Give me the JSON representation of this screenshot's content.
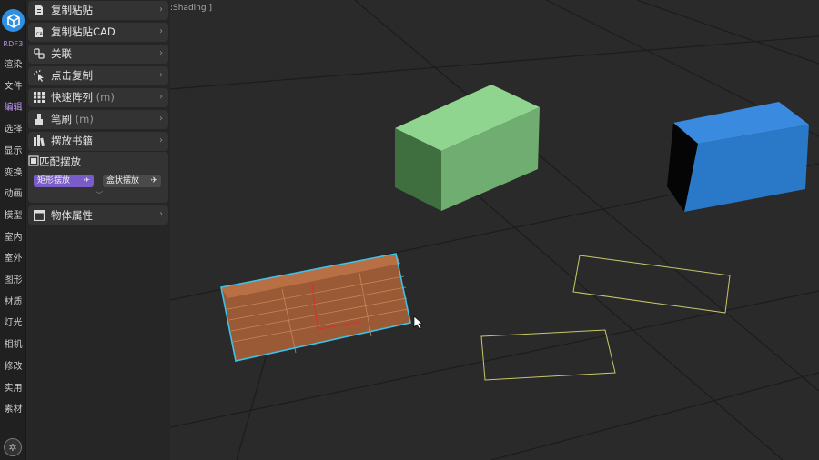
{
  "rail": {
    "brand": "RDF3",
    "items": [
      "渲染",
      "文件",
      "编辑",
      "选择",
      "显示",
      "变换",
      "动画",
      "模型",
      "室内",
      "室外",
      "图形",
      "材质",
      "灯光",
      "相机",
      "修改",
      "实用",
      "素材"
    ],
    "active_index": 2
  },
  "panel": {
    "items": [
      {
        "label": "复制粘贴",
        "suffix": "",
        "icon": "document-icon"
      },
      {
        "label": "复制粘贴CAD",
        "suffix": "",
        "icon": "cad-document-icon"
      },
      {
        "label": "关联",
        "suffix": "",
        "icon": "link-icon"
      },
      {
        "label": "点击复制",
        "suffix": "",
        "icon": "click-icon"
      },
      {
        "label": "快速阵列",
        "suffix": "(m)",
        "icon": "grid-icon"
      },
      {
        "label": "笔刷",
        "suffix": "(m)",
        "icon": "brush-icon"
      },
      {
        "label": "摆放书籍",
        "suffix": "",
        "icon": "books-icon"
      }
    ],
    "expanded": {
      "label": "匹配摆放",
      "icon": "match-icon",
      "buttons": [
        {
          "label": "矩形摆放",
          "active": true
        },
        {
          "label": "盒状摆放",
          "active": false
        }
      ]
    },
    "after": [
      {
        "label": "物体属性",
        "suffix": "",
        "icon": "window-icon"
      }
    ]
  },
  "viewport": {
    "label": ":Shading ]"
  },
  "colors": {
    "accent": "#7a5cc8",
    "selection": "#3fc2e8",
    "green_box": "#7fcc84",
    "blue_box": "#2a78c8",
    "outline": "#c9c86a"
  }
}
